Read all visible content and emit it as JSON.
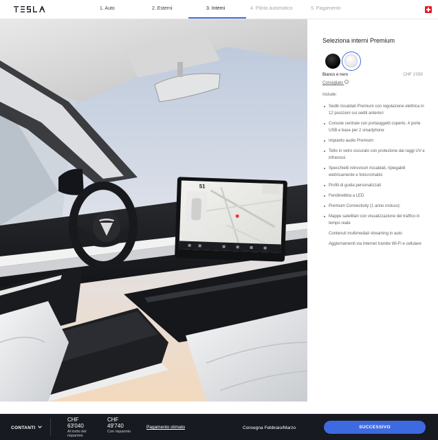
{
  "brand": {
    "logo_text": "TESLA"
  },
  "steps": [
    {
      "label": "1. Auto",
      "state": "done"
    },
    {
      "label": "2. Esterni",
      "state": "done"
    },
    {
      "label": "3. Interni",
      "state": "active"
    },
    {
      "label": "4. Pilota automatico",
      "state": "disabled"
    },
    {
      "label": "5. Pagamento",
      "state": "disabled"
    }
  ],
  "region_flag": "switzerland-flag-icon",
  "panel": {
    "title": "Seleziona interni Premium",
    "swatches": [
      {
        "name": "Tutto nero",
        "color": "#111111",
        "selected": false
      },
      {
        "name": "Bianco e nero",
        "color": "#f2f2f2",
        "selected": true
      }
    ],
    "selected_name": "Bianco e nero",
    "selected_price": "CHF 1'050",
    "recommended": "Consigliato",
    "includes_label": "Include:",
    "features": [
      "Sedili riscaldati Premium con regolazione elettrica in 12 posizioni sui sedili anteriori",
      "Console centrale con portaoggetti coperto, 4 porte USB e base per 2 smartphone",
      "Impianto audio Premium",
      "Tetto in vetro oscurato con protezione dai raggi UV e infrarossi",
      "Specchietti retrovisori riscaldati, ripiegabili elettricamente e fotocromatici",
      "Profili di guida personalizzati",
      "Fendinebbia a LED",
      "Premium Connectivity (1 anno incluso):",
      "",
      "Mappe satellitari con visualizzazione del traffico in tempo reale",
      "Contenuti multimediali streaming in auto",
      "Aggiornamenti via Internet tramite Wi-Fi e cellulare"
    ]
  },
  "screen": {
    "speed": "51"
  },
  "footer": {
    "payment_type": "CONTANTI",
    "price1_currency": "CHF",
    "price1_amount": "63'040",
    "price1_note": "Al lordo del risparmio",
    "price2_currency": "CHF",
    "price2_amount": "49'740",
    "price2_note": "Con risparmio",
    "estimate_link": "Pagamento stimato",
    "delivery": "Consegna Febbraio/Marzo",
    "next_button": "SUCCESSIVO"
  },
  "colors": {
    "accent": "#3e6ae1",
    "footer_bg": "#171a20",
    "text_dark": "#171a20",
    "text_muted": "#5c5e62"
  }
}
